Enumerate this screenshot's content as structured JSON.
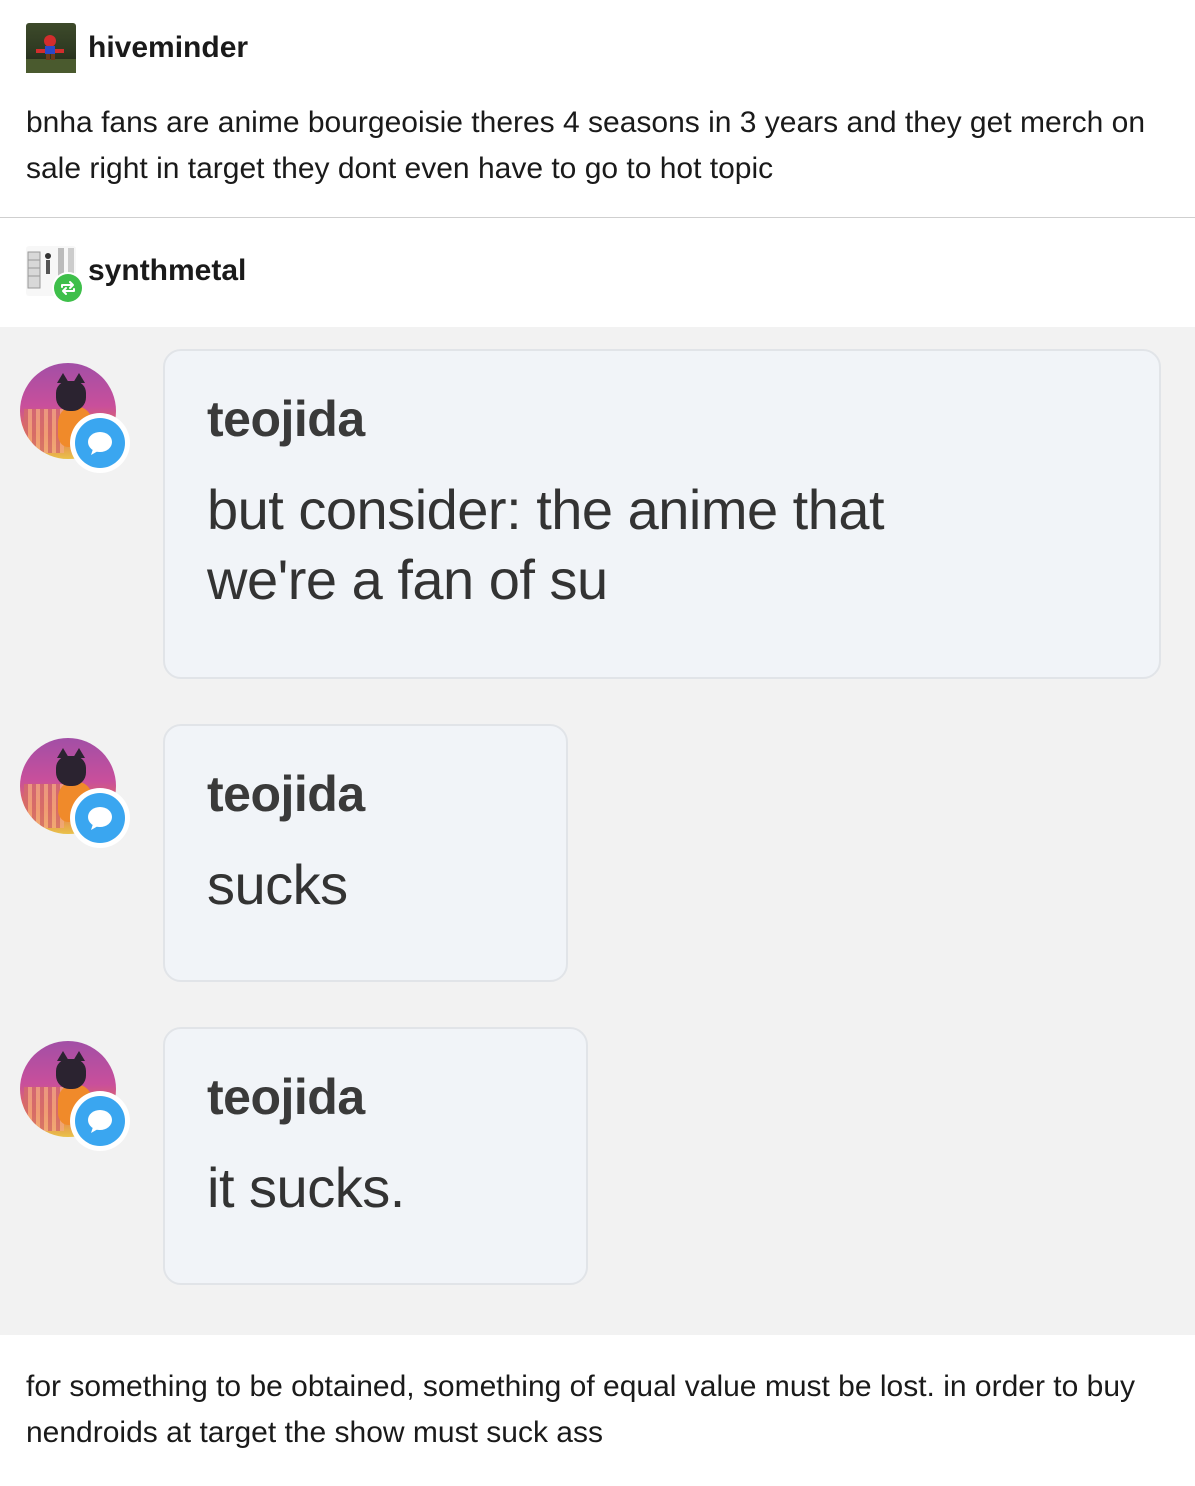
{
  "post": {
    "op": {
      "username": "hiveminder",
      "text": "bnha fans are anime bourgeoisie theres 4 seasons in 3 years and they get merch on sale right in target they dont even have to go to hot topic"
    },
    "reblog": {
      "username": "synthmetal",
      "reblog_icon": "reblog-icon",
      "text": "for something to be obtained, something of equal value must be lost. in order to buy nendroids at target the show must suck ass"
    }
  },
  "chat": {
    "messages": [
      {
        "sender": "teojida",
        "text": "but consider: the anime that we're a fan of su"
      },
      {
        "sender": "teojida",
        "text": "sucks"
      },
      {
        "sender": "teojida",
        "text": "it sucks."
      }
    ],
    "badge_icon": "messenger-icon",
    "colors": {
      "badge": "#3aa6f0",
      "bubble": "#f1f4f8",
      "background": "#f2f2f2"
    }
  }
}
